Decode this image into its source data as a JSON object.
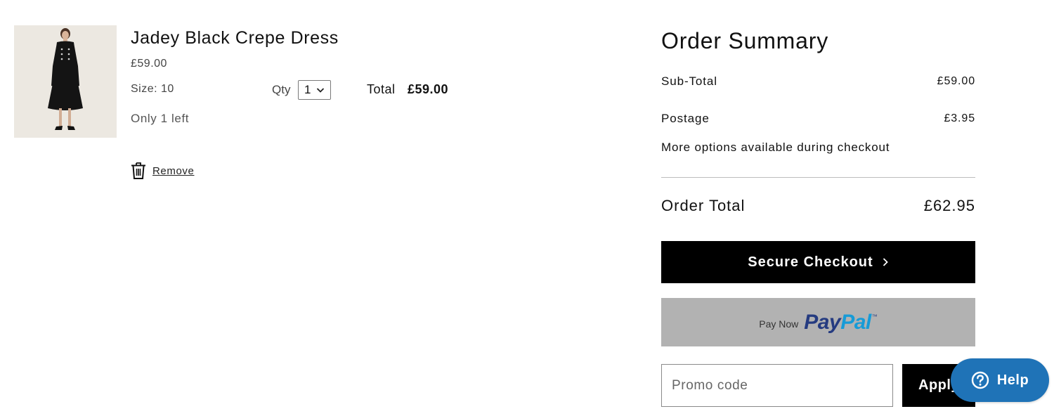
{
  "product": {
    "name": "Jadey Black Crepe Dress",
    "price": "£59.00",
    "size": "Size: 10",
    "stock": "Only 1 left",
    "qty_label": "Qty",
    "qty_value": "1",
    "line_total_label": "Total",
    "line_total_value": "£59.00",
    "remove_label": "Remove"
  },
  "summary": {
    "title": "Order Summary",
    "subtotal_label": "Sub-Total",
    "subtotal_value": "£59.00",
    "postage_label": "Postage",
    "postage_value": "£3.95",
    "postage_note": "More options available during checkout",
    "order_total_label": "Order Total",
    "order_total_value": "£62.95",
    "checkout_label": "Secure Checkout",
    "paypal_prefix": "Pay Now",
    "paypal_word_1": "Pay",
    "paypal_word_2": "Pal",
    "paypal_tm": "™",
    "promo_placeholder": "Promo code",
    "apply_label": "Apply"
  },
  "help": {
    "label": "Help"
  },
  "colors": {
    "checkout_bg": "#000000",
    "paypal_bg": "#b2b2b2",
    "paypal_dark": "#253b80",
    "paypal_light": "#179bd7",
    "help_bg": "#1f73b7"
  },
  "icons": {
    "product_image": "product-thumbnail",
    "qty_dropdown": "chevron-down-icon",
    "remove": "trash-icon",
    "checkout": "chevron-right-icon",
    "help": "question-circle-icon"
  }
}
